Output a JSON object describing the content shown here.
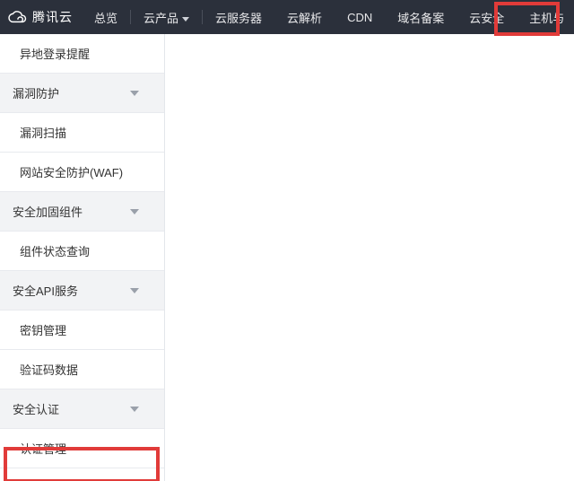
{
  "brand": {
    "text": "腾讯云"
  },
  "nav": {
    "items": [
      {
        "label": "总览"
      },
      {
        "label": "云产品"
      },
      {
        "label": "云服务器"
      },
      {
        "label": "云解析"
      },
      {
        "label": "CDN"
      },
      {
        "label": "域名备案"
      },
      {
        "label": "云安全"
      },
      {
        "label": "主机与"
      }
    ]
  },
  "sidebar": {
    "items": [
      {
        "type": "item",
        "label": "异地登录提醒"
      },
      {
        "type": "header",
        "label": "漏洞防护"
      },
      {
        "type": "item",
        "label": "漏洞扫描"
      },
      {
        "type": "item",
        "label": "网站安全防护(WAF)"
      },
      {
        "type": "header",
        "label": "安全加固组件"
      },
      {
        "type": "item",
        "label": "组件状态查询"
      },
      {
        "type": "header",
        "label": "安全API服务"
      },
      {
        "type": "item",
        "label": "密钥管理"
      },
      {
        "type": "item",
        "label": "验证码数据"
      },
      {
        "type": "header",
        "label": "安全认证"
      },
      {
        "type": "item",
        "label": "认证管理"
      }
    ]
  }
}
